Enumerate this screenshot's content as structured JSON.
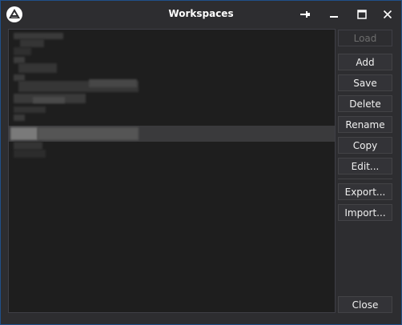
{
  "window": {
    "title": "Workspaces"
  },
  "titlebar_icons": {
    "logo": "app-logo-icon",
    "pin": "pin-icon",
    "minimize": "minimize-icon",
    "maximize": "maximize-icon",
    "close": "close-icon"
  },
  "buttons": {
    "load": "Load",
    "add": "Add",
    "save": "Save",
    "delete": "Delete",
    "rename": "Rename",
    "copy": "Copy",
    "edit": "Edit...",
    "export": "Export...",
    "import": "Import...",
    "close": "Close"
  },
  "colors": {
    "window_bg": "#2d2d30",
    "list_bg": "#1e1e1e",
    "selected_row": "#3a3a3c",
    "border_accent": "#1f4f8a",
    "button_bg": "#333337",
    "disabled_text": "#6d6d6d"
  }
}
